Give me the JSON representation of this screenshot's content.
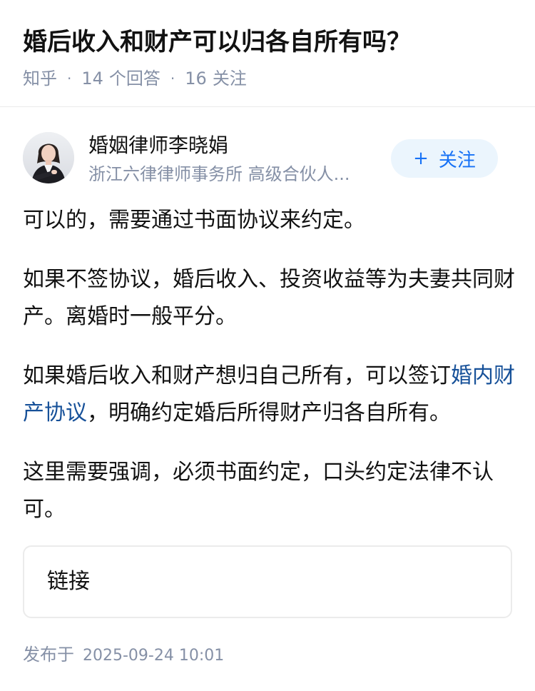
{
  "question": {
    "title": "婚后收入和财产可以归各自所有吗？",
    "source": "知乎",
    "separator": "·",
    "answer_count": "14",
    "answer_label": "个回答",
    "follower_count": "16",
    "follower_label": "关注"
  },
  "author": {
    "name": "婚姻律师李晓娟",
    "title": "浙江六律律师事务所 高级合伙人...",
    "avatar_icon": "avatar-photo",
    "follow_label": "关注",
    "follow_icon": "plus-icon"
  },
  "answer": {
    "p1": "可以的，需要通过书面协议来约定。",
    "p2": "如果不签协议，婚后收入、投资收益等为夫妻共同财产。离婚时一般平分。",
    "p3_before": "如果婚后收入和财产想归自己所有，可以签订",
    "p3_link": "婚内财产协议",
    "p3_after": "，明确约定婚后所得财产归各自所有。",
    "p4": "这里需要强调，必须书面约定，口头约定法律不认可。"
  },
  "link_card": {
    "label": "链接"
  },
  "publish": {
    "prefix": "发布于",
    "datetime": "2025-09-24 10:01"
  },
  "colors": {
    "link": "#175199",
    "accent": "#1772f6",
    "muted": "#8590a6",
    "follow_bg": "#ebf5fd"
  }
}
